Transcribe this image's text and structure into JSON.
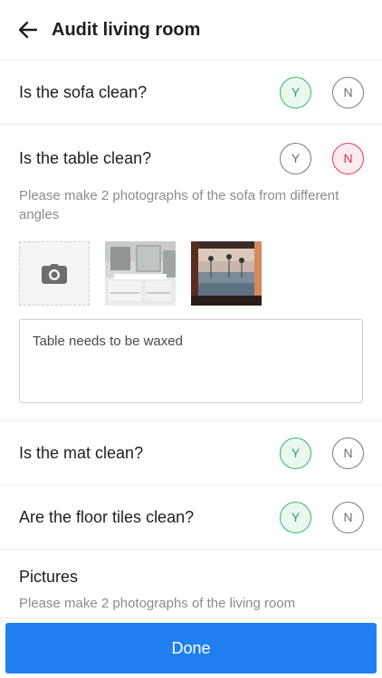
{
  "header": {
    "title": "Audit living room",
    "back_icon": "arrow-left-icon"
  },
  "questions": [
    {
      "text": "Is the sofa clean?",
      "yes": "Y",
      "no": "N",
      "selected": "Y"
    },
    {
      "text": "Is the table clean?",
      "yes": "Y",
      "no": "N",
      "selected": "N"
    },
    {
      "text": "Is the mat clean?",
      "yes": "Y",
      "no": "N",
      "selected": "Y"
    },
    {
      "text": "Are the floor tiles clean?",
      "yes": "Y",
      "no": "N",
      "selected": "Y"
    }
  ],
  "table_block": {
    "hint": "Please make 2 photographs of the sofa from different angles",
    "camera_icon": "camera-icon",
    "note": "Table needs to be waxed"
  },
  "pictures": {
    "title": "Pictures",
    "hint": "Please make 2 photographs of the living room"
  },
  "done_label": "Done",
  "colors": {
    "accent": "#1f7ff0",
    "yes": "#2fb96a",
    "no": "#e03a5c"
  }
}
